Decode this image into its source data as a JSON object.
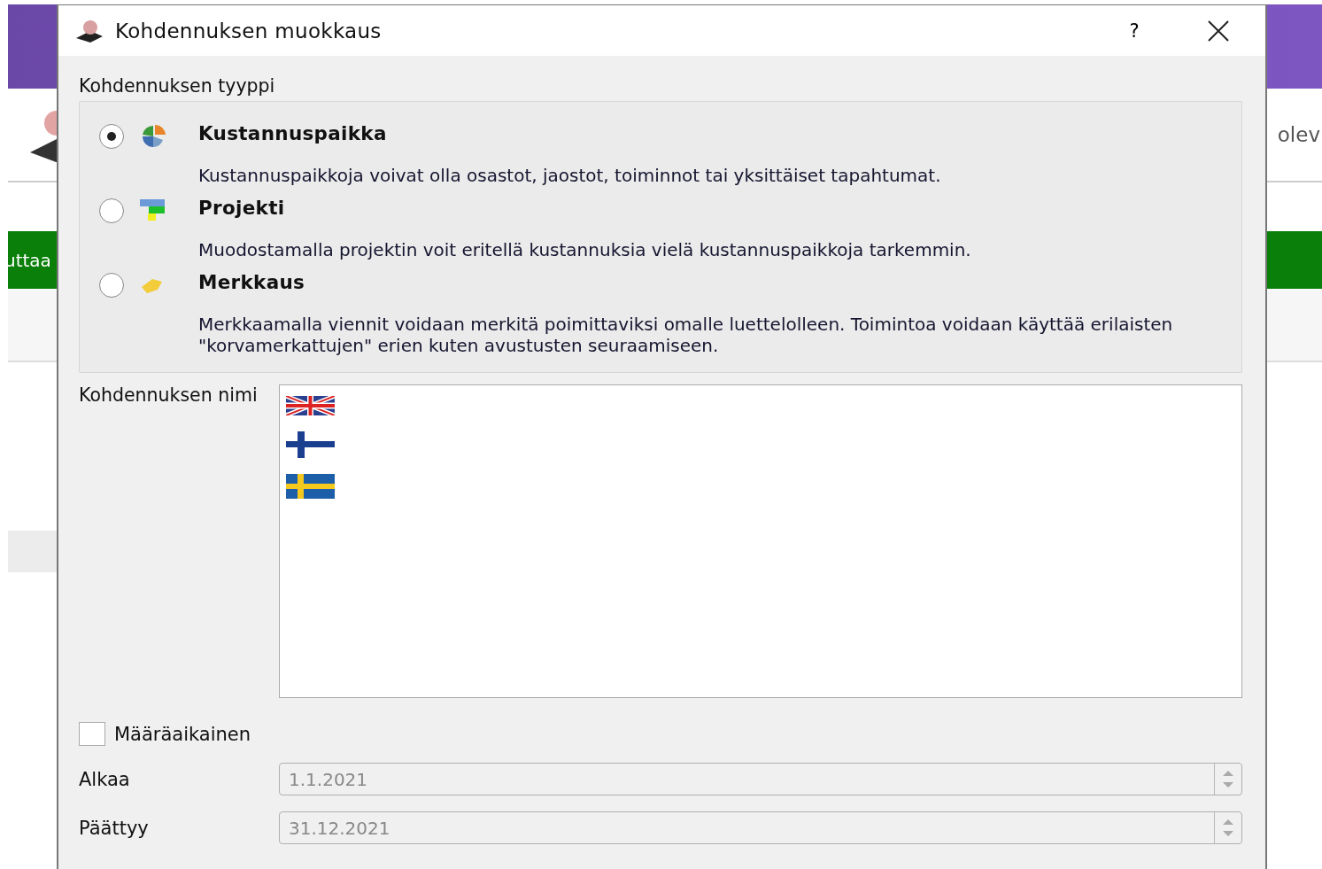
{
  "background": {
    "right_text": "olev",
    "green_bar_text": "uttaa"
  },
  "window": {
    "title": "Kohdennuksen muokkaus",
    "help": "?"
  },
  "type_section": {
    "label": "Kohdennuksen tyyppi",
    "options": [
      {
        "kind": "pie",
        "selected": true,
        "title": "Kustannuspaikka",
        "description": "Kustannuspaikkoja voivat olla osastot, jaostot, toiminnot tai yksittäiset tapahtumat."
      },
      {
        "kind": "blocks",
        "selected": false,
        "title": "Projekti",
        "description": "Muodostamalla projektin voit eritellä kustannuksia vielä kustannuspaikkoja tarkemmin."
      },
      {
        "kind": "tag",
        "selected": false,
        "title": "Merkkaus",
        "description": "Merkkaamalla viennit voidaan merkitä poimittaviksi omalle luettelolleen. Toimintoa voidaan käyttää erilaisten \"korvamerkattujen\" erien kuten avustusten seuraamiseen."
      }
    ]
  },
  "name_field": {
    "label": "Kohdennuksen nimi",
    "languages": [
      {
        "kind": "uk"
      },
      {
        "kind": "fi"
      },
      {
        "kind": "se"
      }
    ]
  },
  "fixed_term": {
    "label": "Määräaikainen",
    "checked": false
  },
  "dates": [
    {
      "label": "Alkaa",
      "value": "1.1.2021",
      "disabled": true
    },
    {
      "label": "Päättyy",
      "value": "31.12.2021",
      "disabled": true
    }
  ]
}
